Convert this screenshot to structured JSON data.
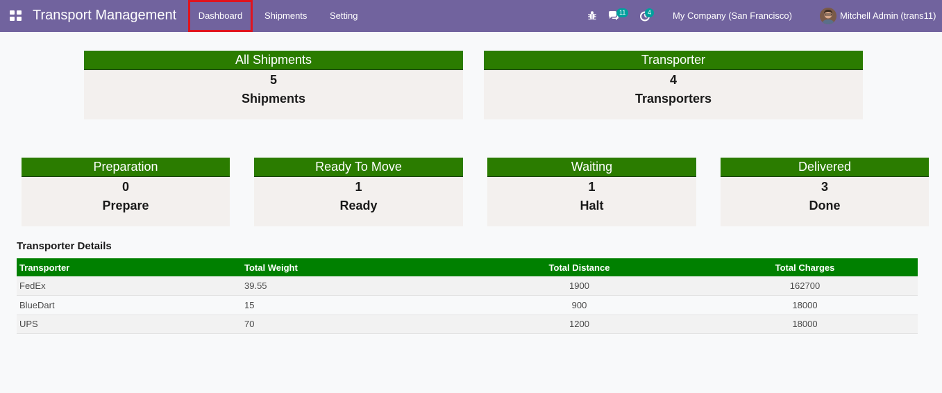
{
  "navbar": {
    "app_title": "Transport Management",
    "menu": [
      "Dashboard",
      "Shipments",
      "Setting"
    ],
    "messages_count": "11",
    "activities_count": "4",
    "company": "My Company (San Francisco)",
    "user": "Mitchell Admin (trans11)"
  },
  "summary_cards": [
    {
      "title": "All Shipments",
      "value": "5",
      "label": "Shipments"
    },
    {
      "title": "Transporter",
      "value": "4",
      "label": "Transporters"
    }
  ],
  "status_cards": [
    {
      "title": "Preparation",
      "value": "0",
      "label": "Prepare"
    },
    {
      "title": "Ready To Move",
      "value": "1",
      "label": "Ready"
    },
    {
      "title": "Waiting",
      "value": "1",
      "label": "Halt"
    },
    {
      "title": "Delivered",
      "value": "3",
      "label": "Done"
    }
  ],
  "transporter_details": {
    "title": "Transporter Details",
    "columns": [
      "Transporter",
      "Total Weight",
      "Total Distance",
      "Total Charges"
    ],
    "rows": [
      [
        "FedEx",
        "39.55",
        "1900",
        "162700"
      ],
      [
        "BlueDart",
        "15",
        "900",
        "18000"
      ],
      [
        "UPS",
        "70",
        "1200",
        "18000"
      ]
    ]
  },
  "colors": {
    "navbar": "#71639e",
    "card_header": "#2b7c00",
    "table_header": "#008000",
    "badge": "#00a09d",
    "active_outline": "#e0141e"
  }
}
